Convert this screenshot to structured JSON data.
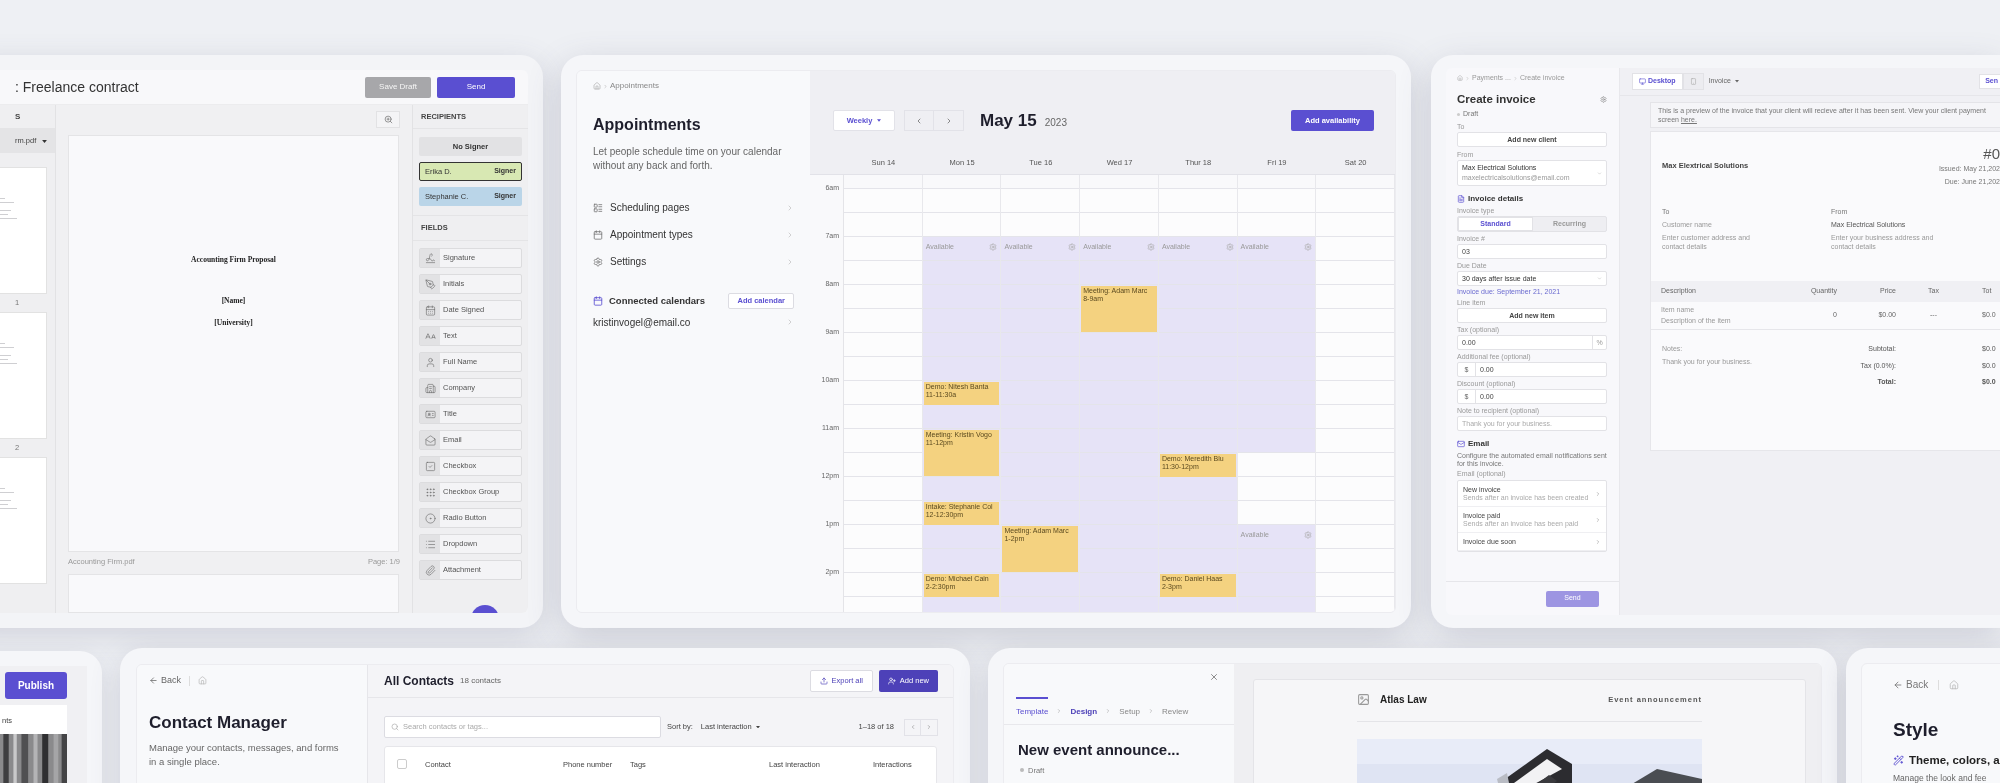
{
  "esign": {
    "title": ": Freelance contract",
    "buttons": [
      {
        "label": "Save Draft",
        "disabled": true
      },
      {
        "label": "Send",
        "disabled": false
      }
    ],
    "documents": {
      "header": "S",
      "file": "rm.pdf",
      "pages": [
        {
          "kind": "page",
          "label": "1"
        },
        {
          "kind": "page",
          "label": "2"
        },
        {
          "kind": "page"
        }
      ]
    },
    "document": {
      "lines": [
        "Accounting Firm Proposal",
        "[Name]",
        "[University]"
      ],
      "file": "Accounting Firm.pdf",
      "page": "Page: 1/9"
    },
    "recipients": {
      "header": "RECIPIENTS",
      "items": [
        {
          "name": "No Signer",
          "color": "#e2e2e4",
          "selected": false
        },
        {
          "name": "Erika D.",
          "role": "Signer",
          "color": "#d8e8b3",
          "selected": true
        },
        {
          "name": "Stephanie C.",
          "role": "Signer",
          "color": "#bad5e8",
          "selected": false
        }
      ]
    },
    "fields": {
      "header": "FIELDS",
      "items": [
        {
          "label": "Signature",
          "kind": "signature"
        },
        {
          "label": "Initials",
          "kind": "initials"
        },
        {
          "label": "Date Signed",
          "kind": "date"
        },
        {
          "label": "Text",
          "kind": "text"
        },
        {
          "label": "Full Name",
          "kind": "name"
        },
        {
          "label": "Company",
          "kind": "company"
        },
        {
          "label": "Title",
          "kind": "title"
        },
        {
          "label": "Email",
          "kind": "email"
        },
        {
          "label": "Checkbox",
          "kind": "checkbox"
        },
        {
          "label": "Checkbox Group",
          "kind": "group"
        },
        {
          "label": "Radio Button",
          "kind": "radio"
        },
        {
          "label": "Dropdown",
          "kind": "dropdown"
        },
        {
          "label": "Attachment",
          "kind": "attachment"
        }
      ]
    }
  },
  "appointments": {
    "breadcrumb": "Appointments",
    "title": "Appointments",
    "description": "Let people schedule time on your calendar without any back and forth.",
    "nav": [
      {
        "label": "Scheduling pages",
        "kind": "pages"
      },
      {
        "label": "Appointment types",
        "kind": "types"
      },
      {
        "label": "Settings",
        "kind": "settings"
      }
    ],
    "calendars": {
      "title": "Connected calendars",
      "button": "Add calendar",
      "items": [
        "kristinvogel@email.co"
      ]
    }
  },
  "calendar": {
    "view": "Weekly",
    "date": "May 15",
    "year": "2023",
    "action": "Add availability",
    "hours": [
      "6am",
      "7am",
      "8am",
      "9am",
      "10am",
      "11am",
      "12pm",
      "1pm",
      "2pm"
    ],
    "days": [
      {
        "label": "Sun 14",
        "slots": [
          {
            "available": false
          },
          {
            "available": false
          },
          {
            "available": false
          },
          {
            "available": false
          },
          {
            "available": false
          },
          {
            "available": false
          },
          {
            "available": false
          },
          {
            "available": false
          },
          {
            "available": false
          },
          {
            "available": false
          },
          {
            "available": false
          },
          {
            "available": false
          },
          {
            "available": false
          },
          {
            "available": false
          },
          {
            "available": false
          },
          {
            "available": false
          },
          {
            "available": false
          },
          {
            "available": false
          }
        ]
      },
      {
        "label": "Mon 15",
        "slots": [
          {
            "available": false
          },
          {
            "available": false
          },
          {
            "available": true,
            "label": "Available"
          },
          {
            "available": true
          },
          {
            "available": true
          },
          {
            "available": true
          },
          {
            "available": true
          },
          {
            "available": true
          },
          {
            "available": true,
            "event": {
              "title": "Demo: Nitesh Banta",
              "time": "11-11:30a",
              "long": false
            }
          },
          {
            "available": true
          },
          {
            "available": true,
            "event": {
              "title": "Meeting: Kristin Vogo",
              "time": "11-12pm",
              "long": true
            }
          },
          {
            "available": true
          },
          {
            "available": true,
            "event": {
              "title": "Intake: Stephanie Col",
              "time": "12-12:30pm",
              "long": false
            }
          },
          {
            "available": true
          },
          {
            "available": true
          },
          {
            "available": true,
            "event": {
              "title": "Demo: Michael Cain",
              "time": "2-2:30pm",
              "long": false
            }
          },
          {
            "available": true
          }
        ]
      },
      {
        "label": "Tue 16",
        "slots": [
          {
            "available": false
          },
          {
            "available": false
          },
          {
            "available": true,
            "label": "Available"
          },
          {
            "available": true
          },
          {
            "available": true
          },
          {
            "available": true
          },
          {
            "available": true
          },
          {
            "available": true
          },
          {
            "available": true
          },
          {
            "available": true
          },
          {
            "available": true
          },
          {
            "available": true
          },
          {
            "available": true
          },
          {
            "available": true
          },
          {
            "available": true,
            "event": {
              "title": "Meeting: Adam Marc",
              "time": "1-2pm",
              "long": true
            }
          },
          {
            "available": true
          },
          {
            "available": true
          }
        ]
      },
      {
        "label": "Wed 17",
        "slots": [
          {
            "available": false
          },
          {
            "available": false
          },
          {
            "available": true,
            "label": "Available"
          },
          {
            "available": true
          },
          {
            "available": true,
            "event": {
              "title": "Meeting: Adam Marc",
              "time": "8-9am",
              "long": true
            }
          },
          {
            "available": true
          },
          {
            "available": true
          },
          {
            "available": true
          },
          {
            "available": true
          },
          {
            "available": true
          },
          {
            "available": true
          },
          {
            "available": true
          },
          {
            "available": true
          },
          {
            "available": true
          },
          {
            "available": true
          },
          {
            "available": true
          },
          {
            "available": true
          }
        ]
      },
      {
        "label": "Thur 18",
        "slots": [
          {
            "available": false
          },
          {
            "available": false
          },
          {
            "available": true,
            "label": "Available"
          },
          {
            "available": true
          },
          {
            "available": true
          },
          {
            "available": true
          },
          {
            "available": true
          },
          {
            "available": true
          },
          {
            "available": true
          },
          {
            "available": true
          },
          {
            "available": true
          },
          {
            "available": true,
            "event": {
              "title": "Demo: Meredith Blu",
              "time": "11:30-12pm",
              "long": false
            }
          },
          {
            "available": true
          },
          {
            "available": true
          },
          {
            "available": true
          },
          {
            "available": true
          },
          {
            "available": true,
            "event": {
              "title": "Demo: Daniel Haas",
              "time": "2-3pm",
              "long": false
            }
          },
          {
            "available": true
          }
        ]
      },
      {
        "label": "Fri 19",
        "slots": [
          {
            "available": false
          },
          {
            "available": false
          },
          {
            "available": true,
            "label": "Available"
          },
          {
            "available": true
          },
          {
            "available": true
          },
          {
            "available": true
          },
          {
            "available": true
          },
          {
            "available": true
          },
          {
            "available": true
          },
          {
            "available": true
          },
          {
            "available": true
          },
          {
            "available": false
          },
          {
            "available": false
          },
          {
            "available": false
          },
          {
            "available": true,
            "label": "Available"
          },
          {
            "available": true
          },
          {
            "available": true
          },
          {
            "available": true
          }
        ]
      },
      {
        "label": "Sat 20",
        "slots": [
          {
            "available": false
          },
          {
            "available": false
          },
          {
            "available": false
          },
          {
            "available": false
          },
          {
            "available": false
          },
          {
            "available": false
          },
          {
            "available": false
          },
          {
            "available": false
          },
          {
            "available": false
          },
          {
            "available": false
          },
          {
            "available": false
          },
          {
            "available": false
          },
          {
            "available": false
          },
          {
            "available": false
          },
          {
            "available": false
          },
          {
            "available": false
          },
          {
            "available": false
          },
          {
            "available": false
          }
        ]
      }
    ]
  },
  "invoice": {
    "breadcrumb": [
      "Payments ...",
      "Create invoice"
    ],
    "title": "Create invoice",
    "status": "Draft",
    "top": [
      {
        "kind": "button",
        "label": "To",
        "text": "Add new client"
      },
      {
        "kind": "select",
        "label": "From",
        "value": "Max Electrical Solutions",
        "sub": "maxelectricalsolutions@email.com"
      }
    ],
    "details": {
      "title": "Invoice details",
      "fields": [
        {
          "kind": "toggle",
          "label": "Invoice type",
          "options": [
            {
              "label": "Standard",
              "selected": true
            },
            {
              "label": "Recurring",
              "selected": false
            }
          ]
        },
        {
          "kind": "input",
          "label": "Invoice #",
          "value": "03"
        },
        {
          "kind": "select",
          "label": "Due Date",
          "value": "30 days after issue date",
          "hint": "Invoice due: September 21, 2021"
        },
        {
          "kind": "button",
          "label": "Line item",
          "text": "Add new item"
        },
        {
          "kind": "input",
          "label": "Tax (optional)",
          "value": "0.00",
          "suffix": "%"
        },
        {
          "kind": "input",
          "label": "Additional fee (optional)",
          "value": "0.00",
          "prefix": "$"
        },
        {
          "kind": "input",
          "label": "Discount (optional)",
          "value": "0.00",
          "prefix": "$"
        },
        {
          "kind": "input",
          "label": "Note to recipient (optional)",
          "placeholder": "Thank you for your business."
        }
      ]
    },
    "email": {
      "title": "Email",
      "description": "Configure the automated email notifications sent for this invoice.",
      "label": "Email (optional)",
      "items": [
        {
          "title": "New invoice",
          "sub": "Sends after an invoice has been created"
        },
        {
          "title": "Invoice paid",
          "sub": "Sends after an invoice has been paid"
        },
        {
          "title": "Invoice due soon"
        }
      ]
    },
    "send": {
      "label": "Send",
      "disabled": true
    },
    "tabs": [
      {
        "kind": "desktop",
        "label": "Desktop",
        "selected": true
      },
      {
        "kind": "mobile",
        "selected": false
      }
    ],
    "doc_select": "Invoice",
    "send_top": "Sen",
    "notice": {
      "text": "This is a preview of the invoice that your client will recieve after it has been sent. View your client payment screen ",
      "link": "here."
    },
    "preview": {
      "company": "Max Elextrical Solutions",
      "number": "#0",
      "issued": "Issued: May 21,202",
      "due": "Due: June 21,202",
      "parties": [
        {
          "label": "To",
          "name": "Customer name",
          "details": "Enter customer address and contact details"
        },
        {
          "label": "From",
          "name": "Max Electrical Solutions",
          "details": "Enter your business address and contact details"
        }
      ],
      "columns": [
        "Description",
        "Quantity",
        "Price",
        "Tax",
        "Tot"
      ],
      "rows": [
        {
          "name": "Item name",
          "description": "Description of the item",
          "quantity": "0",
          "price": "$0.00",
          "tax": "---",
          "total": "$0.0"
        }
      ],
      "notes": {
        "label": "Notes:",
        "text": "Thank you for your business."
      },
      "totals": [
        {
          "label": "Subtotal:",
          "value": "$0.0",
          "bold": false
        },
        {
          "label": "Tax (0.0%):",
          "value": "$0.0",
          "bold": false
        },
        {
          "label": "Total:",
          "value": "$0.0",
          "bold": true
        }
      ]
    }
  },
  "publish": {
    "button": "Publish",
    "label": "nts"
  },
  "contacts": {
    "back": "Back",
    "title": "Contact Manager",
    "description": "Manage your contacts, messages, and forms in a single place.",
    "list_title": "All Contacts",
    "count": "18 contacts",
    "actions": [
      {
        "label": "Export all",
        "kind": "export"
      },
      {
        "label": "Add new",
        "kind": "add"
      }
    ],
    "search": {
      "placeholder": "Search contacts or tags..."
    },
    "sort": {
      "label": "Sort by:",
      "value": "Last interaction"
    },
    "range": "1–18 of 18",
    "select_all": {
      "checked": false
    },
    "columns": [
      "Contact",
      "Phone number",
      "Tags",
      "Last interaction",
      "Interactions"
    ]
  },
  "event": {
    "steps": [
      {
        "label": "Template",
        "selected": false,
        "completed": true
      },
      {
        "label": "Design",
        "selected": true,
        "completed": false
      },
      {
        "label": "Setup",
        "selected": false,
        "completed": false
      },
      {
        "label": "Review",
        "selected": false,
        "completed": false
      }
    ],
    "title": "New event announce...",
    "status": "Draft",
    "brand": "Atlas Law",
    "email_type": "Event announcement"
  },
  "style": {
    "back": "Back",
    "title": "Style",
    "subtitle": "Theme, colors, a",
    "description": "Manage the look and fee"
  }
}
